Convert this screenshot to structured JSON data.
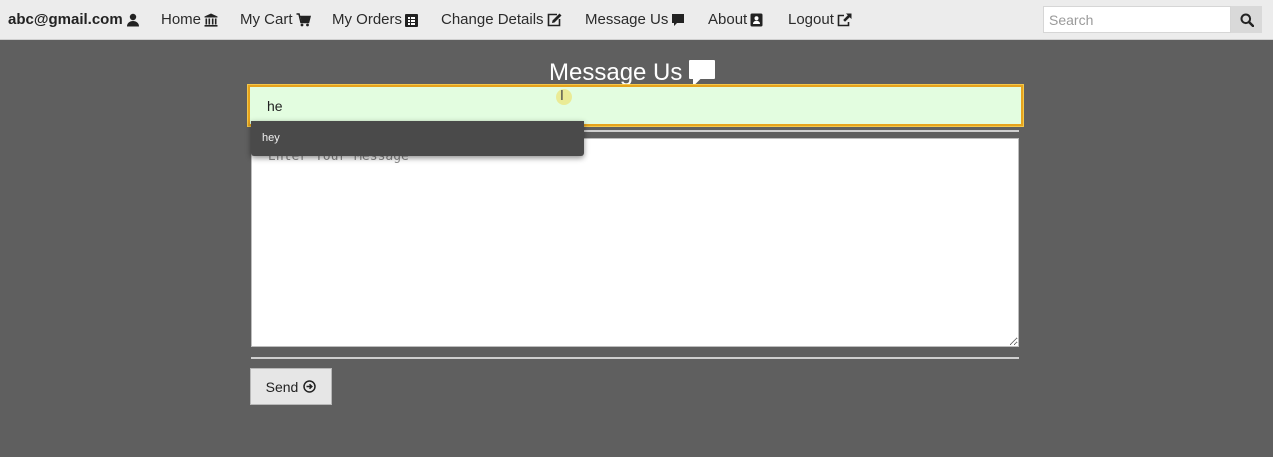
{
  "nav": {
    "user_email": "abc@gmail.com",
    "home": "Home",
    "my_cart": "My Cart",
    "my_orders": "My Orders",
    "change_details": "Change Details",
    "message_us": "Message Us",
    "about": "About",
    "logout": "Logout",
    "search_placeholder": "Search",
    "icons": [
      "user-icon",
      "bank-icon",
      "cart-icon",
      "list-icon",
      "edit-icon",
      "comment-icon",
      "address-card-icon",
      "logout-icon",
      "search-icon"
    ]
  },
  "page": {
    "heading": "Message Us",
    "subject_value": "he",
    "autocomplete_suggestion": "hey",
    "message_placeholder": "Enter Your Message",
    "send_label": "Send"
  },
  "colors": {
    "background": "#5f5f5f",
    "navbar": "#ececec",
    "input_focus_bg": "#e3fde0",
    "input_focus_border": "#e6a31c"
  }
}
